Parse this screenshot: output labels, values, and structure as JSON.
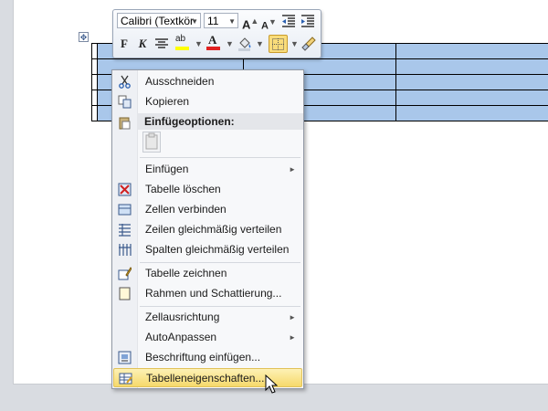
{
  "toolbar": {
    "font_name": "Calibri (Textkör",
    "font_size": "11",
    "grow_font": "A",
    "shrink_font": "A",
    "bold": "F",
    "italic": "K",
    "highlight_text": "ab",
    "font_color_text": "A"
  },
  "menu": {
    "items": [
      {
        "label": "Ausschneiden",
        "icon": "scissors-icon"
      },
      {
        "label": "Kopieren",
        "icon": "copy-icon"
      },
      {
        "label": "Einfügeoptionen:",
        "icon": "paste-icon"
      },
      {
        "label": "Einfügen",
        "submenu": true
      },
      {
        "label": "Tabelle löschen",
        "icon": "delete-table-icon"
      },
      {
        "label": "Zellen verbinden",
        "icon": "merge-cells-icon"
      },
      {
        "label": "Zeilen gleichmäßig verteilen",
        "icon": "distribute-rows-icon"
      },
      {
        "label": "Spalten gleichmäßig verteilen",
        "icon": "distribute-columns-icon"
      },
      {
        "label": "Tabelle zeichnen",
        "icon": "draw-table-icon"
      },
      {
        "label": "Rahmen und Schattierung...",
        "icon": "borders-icon"
      },
      {
        "label": "Zellausrichtung",
        "submenu": true
      },
      {
        "label": "AutoAnpassen",
        "submenu": true
      },
      {
        "label": "Beschriftung einfügen...",
        "icon": "caption-icon"
      },
      {
        "label": "Tabelleneigenschaften...",
        "icon": "table-properties-icon",
        "highlighted": true
      }
    ],
    "submenu_arrow": "►"
  },
  "colors": {
    "table_selection": "#a9c7ea",
    "hover_highlight": "#f6d96b",
    "font_color_bar": "#e02020",
    "highlight_bar": "#ffff00"
  }
}
